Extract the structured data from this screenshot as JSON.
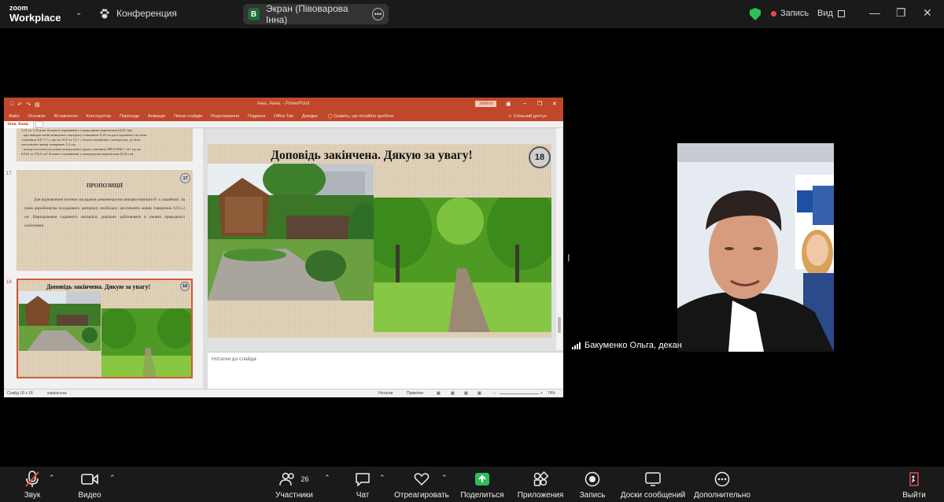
{
  "topbar": {
    "logo_line1": "zoom",
    "logo_line2": "Workplace",
    "conference_label": "Конференция",
    "screen_avatar": "В",
    "screen_label": "Экран (Півоварова Інна)",
    "recording_label": "Запись",
    "view_label": "Вид"
  },
  "colors": {
    "accent_green": "#2dbf58",
    "recording_red": "#e5484d",
    "ppt_red": "#c0472a"
  },
  "powerpoint": {
    "title": "Інна. Анна.  -  PowerPoint",
    "login_button": "Увійти",
    "tabs": [
      "Файл",
      "Основне",
      "Вставлення",
      "Конструктор",
      "Переходи",
      "Анімація",
      "Показ слайдів",
      "Рецензування",
      "Подання",
      "Office Tab",
      "Довідка"
    ],
    "tell_me": "Скажіть, що потрібно зробити",
    "share_access": "Спільний доступ",
    "document_tab": "Інна. Анна.",
    "slide16_lines": [
      "3,35 та 1,25 рази більше в порівнянні з попередніми варіантами (0,45 см);",
      "- при використанні живцевого матеріалу товщиною 0,45 см.дата кореневої системи",
      "становила 8,0-7,1 с, що на 10,0 та 12,7 с більше порівнянь з контролем, де були",
      "заготовлені живці товщиною 1,2 см;",
      "- площа листя на рослинах контрольної групи становила 800,0-906,7 см², що на",
      "618,0 та 576,0 см² більше в порівнянні з попередніми варіантами (0,45 см)."
    ],
    "slide17_number": "17",
    "slide17_heading": "ПРОПОЗИЦІЇ",
    "slide17_text": "Для відновлення зелених насаджень рекомендуємо використовувати P. x canadensis. За умов виробництва посадкового матеріалу необхідно заготовляти живці товщиною 0,9-1,2 см. Вирощування садивного матеріалу доцільно здійснювати в умовах природного освітлення.",
    "slide18_number": "18",
    "slide18_heading": "Доповідь закінчена.  Дякую за увагу!",
    "notes_placeholder": "Нотатки до слайда",
    "status_slide": "Слайд 18 з 18",
    "status_language": "українська",
    "status_notes": "Нотатки",
    "status_comments": "Примітки",
    "zoom_percent": "74%"
  },
  "video": {
    "participant_name": "Бакуменко Ольга, декан"
  },
  "bottombar": {
    "mute": "Звук",
    "video": "Видео",
    "participants": "Участники",
    "participants_count": "26",
    "chat": "Чат",
    "react": "Отреагировать",
    "share": "Поделиться",
    "apps": "Приложения",
    "record": "Запись",
    "whiteboards": "Доски сообщений",
    "more": "Дополнительно",
    "leave": "Выйти"
  }
}
